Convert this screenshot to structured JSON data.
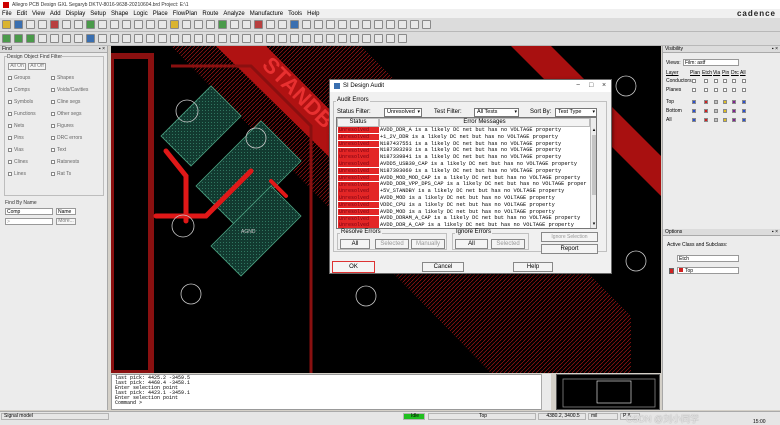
{
  "window": {
    "title": "Allegro PCB Design GXL Segaryb DKTV-8016-9638-20210604.brd  Project: E:\\1"
  },
  "menu": [
    "File",
    "Edit",
    "View",
    "Add",
    "Display",
    "Setup",
    "Shape",
    "Logic",
    "Place",
    "FlowPlan",
    "Route",
    "Analyze",
    "Manufacture",
    "Tools",
    "Help"
  ],
  "brand": "cadence",
  "left_panel": {
    "title": "Find",
    "group_title": "Design Object Find Filter",
    "all_on": "All On",
    "all_off": "All Off",
    "left_items": [
      "Groups",
      "Comps",
      "Symbols",
      "Functions",
      "Nets",
      "Pins",
      "Vias",
      "Clines",
      "Lines"
    ],
    "right_items": [
      "Shapes",
      "Voids/Cavities",
      "Cline segs",
      "Other segs",
      "Figures",
      "DRC errors",
      "Text",
      "Ratsnests",
      "Rat Ts"
    ],
    "find_by_name": "Find By Name",
    "type_value": "Comp",
    "name_value": "Name",
    "more": "More..."
  },
  "canvas": {
    "board_label": "STANDBY",
    "pad_label": "AGND"
  },
  "dialog": {
    "title": "SI Design Audit",
    "audit_group": "Audit Errors",
    "status_filter_label": "Status Filter:",
    "status_filter_value": "Unresolved",
    "test_filter_label": "Test Filter:",
    "test_filter_value": "All Tests",
    "sort_by_label": "Sort By:",
    "sort_by_value": "Test Type",
    "col_status": "Status",
    "col_messages": "Error Messages",
    "rows": [
      {
        "status": "Unresolved",
        "message": "AVDD_DDR_A is a likely DC net but has no VOLTAGE property"
      },
      {
        "status": "Unresolved",
        "message": "+1_2V_DDR is a likely DC net but has no VOLTAGE property"
      },
      {
        "status": "Unresolved",
        "message": "N187437551 is a likely DC net but has no VOLTAGE property"
      },
      {
        "status": "Unresolved",
        "message": "N187303293 is a likely DC net but has no VOLTAGE property"
      },
      {
        "status": "Unresolved",
        "message": "N187339841 is a likely DC net but has no VOLTAGE property"
      },
      {
        "status": "Unresolved",
        "message": "AVDD5_USB30_CAP is a likely DC net but has no VOLTAGE property"
      },
      {
        "status": "Unresolved",
        "message": "N187303060 is a likely DC net but has no VOLTAGE property"
      },
      {
        "status": "Unresolved",
        "message": "AVDD_MOD_MOD_CAP is a likely DC net but has no VOLTAGE property"
      },
      {
        "status": "Unresolved",
        "message": "AVDD_DDR_VPP_DPS_CAP is a likely DC net but has no VOLTAGE proper"
      },
      {
        "status": "Unresolved",
        "message": "+5V_STANDBY is a likely DC net but has no VOLTAGE property"
      },
      {
        "status": "Unresolved",
        "message": "AVDD_MOD is a likely DC net but has no VOLTAGE property"
      },
      {
        "status": "Unresolved",
        "message": "VDDC_CPU is a likely DC net but has no VOLTAGE property"
      },
      {
        "status": "Unresolved",
        "message": "AVDD_MOD is a likely DC net but has no VOLTAGE property"
      },
      {
        "status": "Unresolved",
        "message": "AVDD_DDRAM_A_CAP is a likely DC net but has no VOLTAGE property"
      },
      {
        "status": "Unresolved",
        "message": "AVDD_DDR_A_CAP is a likely DC net but has no VOLTAGE property"
      }
    ],
    "resolve_group": "Resolve Errors",
    "ignore_group": "Ignore Errors",
    "all": "All",
    "selected": "Selected",
    "manually": "Manually",
    "ignore_selection": "Ignore Selection",
    "report": "Report",
    "ok": "OK",
    "cancel": "Cancel",
    "help": "Help"
  },
  "right_panel": {
    "visibility_title": "Visibility",
    "views_label": "Views:",
    "views_value": "Film: astf",
    "layer_label": "Layer",
    "cols": [
      "Plan",
      "Etch",
      "Via",
      "Pin",
      "Drc",
      "All"
    ],
    "rows": [
      "Conductors",
      "Planes",
      "Top",
      "Bottom",
      "All"
    ],
    "options_title": "Options",
    "active_class_label": "Active Class and Subclass:",
    "class_value": "Etch",
    "subclass_value": "Top",
    "swatch_colors": [
      "#2a4fd0",
      "#d02020",
      "#c0c0c0",
      "#e0c020",
      "#802090"
    ]
  },
  "console": {
    "lines": [
      "last pick:  4425.2 -3459.5",
      "last pick:  4460.4 -3458.1",
      "Enter selection point",
      "last pick:  4423.1 -3459.1",
      "Enter selection point",
      "Command >"
    ]
  },
  "status": {
    "mode": "Signal model",
    "state": "Idle",
    "layer": "Top",
    "coords": "4380.2, 3400.5",
    "unit": "mil",
    "flags": "P  A",
    "clock": "15:00",
    "watermark": "CSDN @刘小同学"
  }
}
